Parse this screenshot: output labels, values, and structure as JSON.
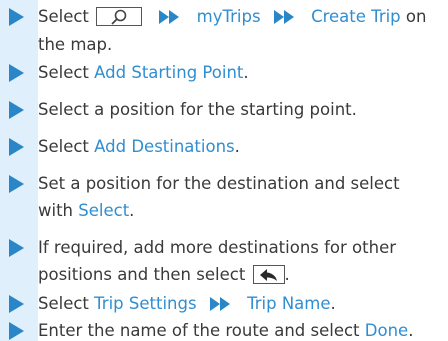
{
  "colors": {
    "band": "#dfeffb",
    "arrow": "#2a86c6",
    "highlight": "#2f8ed1",
    "text": "#3a3a3a"
  },
  "icons": {
    "bullet": "triangle-right-icon",
    "forward": "double-chevron-right-icon",
    "search": "magnifier-icon",
    "back": "back-arrow-icon"
  },
  "steps": [
    {
      "select": "Select",
      "mytrips": "myTrips",
      "create_trip": "Create Trip",
      "on": "on",
      "the_map": "the map."
    },
    {
      "select": "Select",
      "add_starting_point": "Add Starting Point",
      "period": "."
    },
    {
      "text": "Select a position for the starting point."
    },
    {
      "select": "Select",
      "add_destinations": "Add Destinations",
      "period": "."
    },
    {
      "line1": "Set a position for the destination and select",
      "with": "with",
      "select_btn": "Select",
      "period": "."
    },
    {
      "line1": "If required, add more destinations for other",
      "line2": "positions and then select",
      "period": "."
    },
    {
      "select": "Select",
      "trip_settings": "Trip Settings",
      "trip_name": "Trip Name",
      "period": "."
    },
    {
      "text": "Enter the name of the route and select",
      "done": "Done",
      "period": "."
    }
  ]
}
